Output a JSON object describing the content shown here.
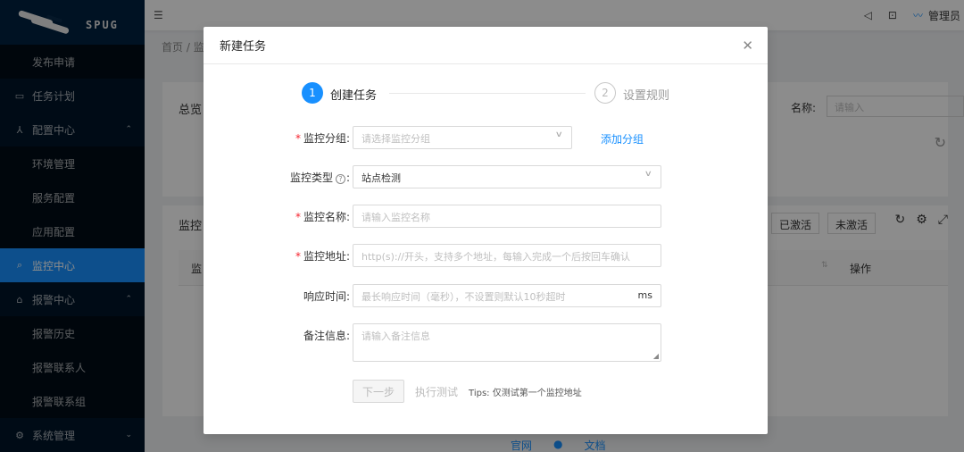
{
  "app": {
    "logo_text": "SPUG"
  },
  "sidebar": {
    "items": [
      {
        "label": "发布申请",
        "type": "sub"
      },
      {
        "label": "任务计划",
        "type": "top",
        "icon": "calendar-icon"
      },
      {
        "label": "配置中心",
        "type": "top",
        "icon": "cluster-icon",
        "expanded": true
      },
      {
        "label": "环境管理",
        "type": "sub"
      },
      {
        "label": "服务配置",
        "type": "sub"
      },
      {
        "label": "应用配置",
        "type": "sub"
      },
      {
        "label": "监控中心",
        "type": "top",
        "icon": "search-icon",
        "active": true
      },
      {
        "label": "报警中心",
        "type": "top",
        "icon": "alarm-icon",
        "expanded": true
      },
      {
        "label": "报警历史",
        "type": "sub"
      },
      {
        "label": "报警联系人",
        "type": "sub"
      },
      {
        "label": "报警联系组",
        "type": "sub"
      },
      {
        "label": "系统管理",
        "type": "top",
        "icon": "gear-icon",
        "expanded": false
      }
    ]
  },
  "header": {
    "user": "管理员"
  },
  "page": {
    "breadcrumb_home": "首页",
    "breadcrumb_sep": "/",
    "breadcrumb_current": "监",
    "overview_title": "总览",
    "name_label": "名称:",
    "name_placeholder": "请输入",
    "list_title": "监控",
    "seg_active": "已激活",
    "seg_inactive": "未激活",
    "table_col1": "监",
    "table_ops": "操作",
    "footer": {
      "site": "官网",
      "docs": "文档"
    }
  },
  "modal": {
    "title": "新建任务",
    "steps": [
      {
        "number": "1",
        "title": "创建任务",
        "status": "active"
      },
      {
        "number": "2",
        "title": "设置规则",
        "status": "wait"
      }
    ],
    "fields": {
      "group": {
        "label": "监控分组",
        "required": true,
        "placeholder": "请选择监控分组",
        "add_link": "添加分组"
      },
      "type": {
        "label": "监控类型",
        "required": false,
        "value": "站点检测"
      },
      "name": {
        "label": "监控名称",
        "required": true,
        "placeholder": "请输入监控名称"
      },
      "address": {
        "label": "监控地址",
        "required": true,
        "placeholder": "http(s)://开头，支持多个地址，每输入完成一个后按回车确认"
      },
      "timeout": {
        "label": "响应时间",
        "required": false,
        "placeholder": "最长响应时间（毫秒），不设置则默认10秒超时",
        "suffix": "ms"
      },
      "remark": {
        "label": "备注信息",
        "required": false,
        "placeholder": "请输入备注信息"
      }
    },
    "buttons": {
      "next": "下一步",
      "test": "执行测试"
    },
    "tips": "Tips: 仅测试第一个监控地址"
  }
}
